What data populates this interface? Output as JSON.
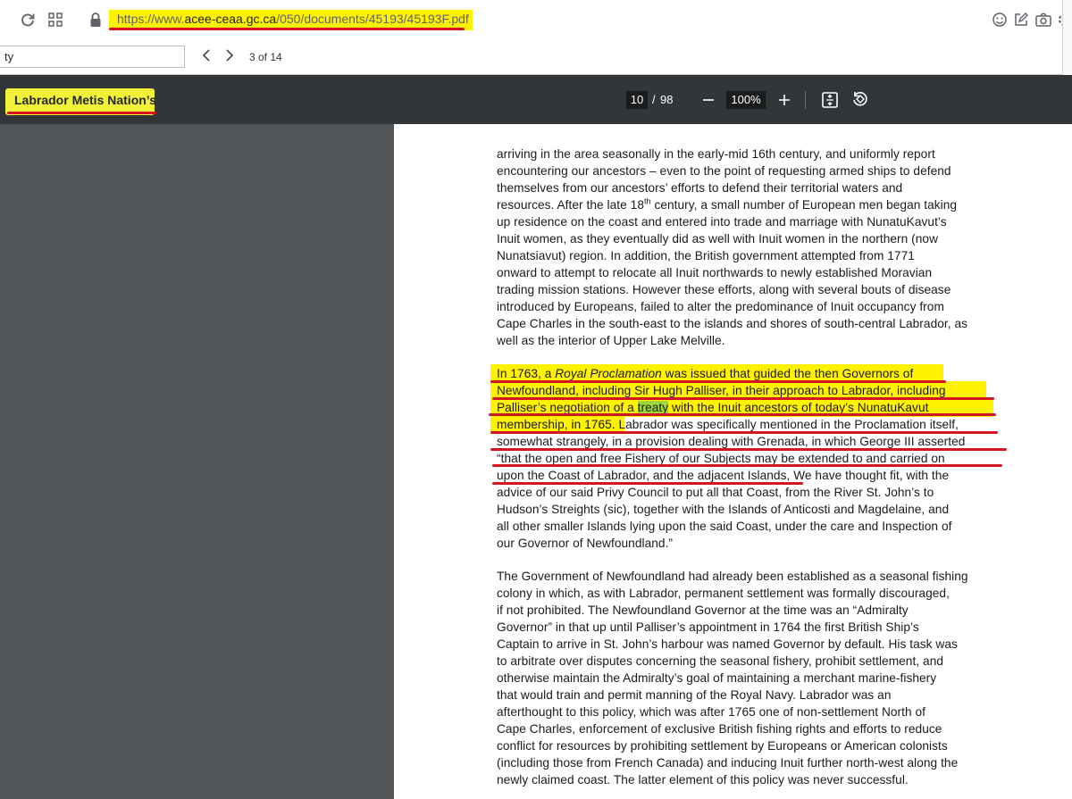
{
  "browser": {
    "url_prefix": "https://www.",
    "url_domain": "acee-ceaa.gc.ca",
    "url_path": "/050/documents/45193/45193F.pdf",
    "find": {
      "query": "ty",
      "count": "3 of 14"
    }
  },
  "pdf_toolbar": {
    "title": "Labrador Metis Nation’s",
    "page_current": "10",
    "page_separator": "/",
    "page_total": "98",
    "zoom": "100%"
  },
  "colors": {
    "highlight": "#fff200",
    "underline": "#d41622",
    "toolbar": "#323639",
    "viewer_bg": "#525659"
  },
  "document": {
    "p1": {
      "l1": "arriving in the area seasonally in the early-mid 16th century, and uniformly report",
      "l2": "encountering our ancestors – even to the point of requesting armed ships to defend",
      "l3": "themselves from our ancestors’ efforts to defend their territorial waters and",
      "l4a": "resources.  After the late 18",
      "l4sup": "th",
      "l4b": " century, a small number of European men began taking",
      "l5": "up residence on the coast and entered into trade and marriage with NunatuKavut’s",
      "l6": "Inuit women, as they eventually did as well with Inuit women in the northern (now",
      "l7": "Nunatsiavut) region.  In addition, the British government attempted from 1771",
      "l8": "onward to attempt to relocate all Inuit northwards to newly established Moravian",
      "l9": "trading mission stations.  However these efforts, along with several bouts of disease",
      "l10": "introduced by Europeans, failed to alter the predominance of Inuit occupancy from",
      "l11": "Cape Charles in the south-east to the islands and shores of south-central Labrador, as",
      "l12": "well as the interior of Upper Lake Melville."
    },
    "p2": {
      "l1a": "In 1763, a ",
      "l1i": "Royal Proclamation",
      "l1b": " was issued that guided the then Governors of",
      "l2": "Newfoundland, including Sir Hugh Palliser, in their approach to Labrador, including",
      "l3a": "Palliser’s negotiation of a ",
      "l3t": "treaty",
      "l3b": " with the Inuit ancestors of today’s NunatuKavut",
      "l4a": "membership, in 1765. ",
      "l4b": " Labrador was specifically mentioned in the Proclamation itself,",
      "l5": "somewhat strangely, in a provision dealing with Grenada, in which George III asserted",
      "l6": "“that the open and free Fishery of our Subjects may be extended to and carried on",
      "l7a": "upon the Coast of Labrador, and the adjacent Islands,",
      "l7b": " We have thought fit, with the",
      "l8": "advice of our said Privy Council to put all that Coast, from the River St. John’s to",
      "l9": "Hudson’s Streights (sic), together with the Islands of Anticosti and Magdelaine, and",
      "l10": "all other smaller Islands lying upon the said Coast, under the care and Inspection of",
      "l11": "our Governor of Newfoundland.”"
    },
    "p3": {
      "l1": "The Government of Newfoundland had already been established as a seasonal fishing",
      "l2": "colony in which, as with Labrador, permanent settlement was formally discouraged,",
      "l3": "if not prohibited.  The Newfoundland Governor at the time was an “Admiralty",
      "l4": "Governor” in that up until Palliser’s appointment in 1764 the first British Ship’s",
      "l5": "Captain to arrive in St. John’s harbour was named Governor by default.  His task was",
      "l6": "to arbitrate over disputes concerning the seasonal fishery, prohibit settlement, and",
      "l7": "otherwise maintain the Admiralty’s goal of maintaining a merchant marine-fishery",
      "l8": "that would train and permit manning of the Royal Navy.  Labrador was an",
      "l9": "afterthought to this policy, which was after 1765 one of non-settlement North of",
      "l10": "Cape Charles, enforcement of exclusive British fishing rights and efforts to reduce",
      "l11": "conflict for resources by prohibiting settlement by Europeans or American colonists",
      "l12": "(including those from French Canada) and inducing Inuit further north-west along the",
      "l13": "newly claimed coast.  The latter element of this policy was never successful."
    }
  }
}
